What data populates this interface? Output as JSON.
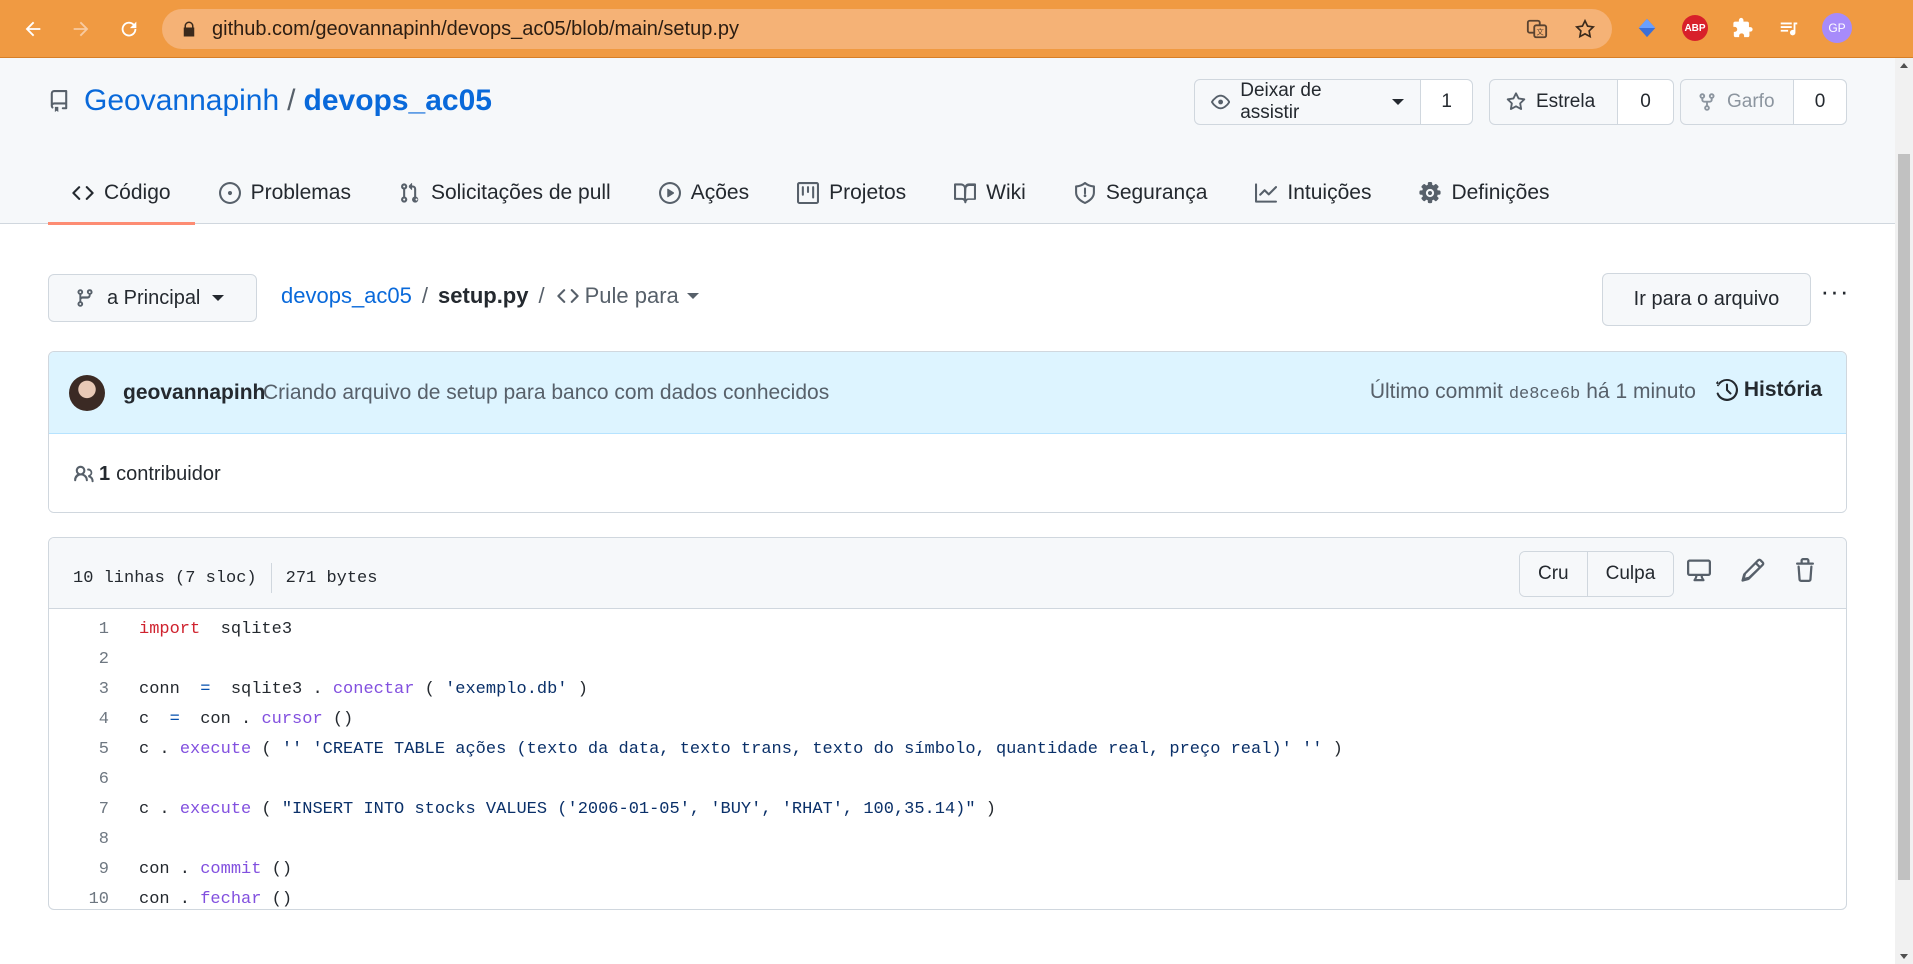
{
  "browser": {
    "url": "github.com/geovannapinh/devops_ac05/blob/main/setup.py",
    "profile_initials": "GP",
    "abp_label": "ABP",
    "accent_color": "#f09a42"
  },
  "repo": {
    "owner": "Geovannapinh",
    "separator": "/",
    "name": "devops_ac05",
    "watch": {
      "label": "Deixar de assistir",
      "count": "1"
    },
    "star": {
      "label": "Estrela",
      "count": "0"
    },
    "fork": {
      "label": "Garfo",
      "count": "0"
    }
  },
  "tabs": [
    {
      "label": "Código",
      "icon": "code-icon",
      "active": true
    },
    {
      "label": "Problemas",
      "icon": "issue-icon"
    },
    {
      "label": "Solicitações de pull",
      "icon": "pull-request-icon"
    },
    {
      "label": "Ações",
      "icon": "play-icon"
    },
    {
      "label": "Projetos",
      "icon": "project-icon"
    },
    {
      "label": "Wiki",
      "icon": "book-icon"
    },
    {
      "label": "Segurança",
      "icon": "shield-icon"
    },
    {
      "label": "Intuições",
      "icon": "graph-icon"
    },
    {
      "label": "Definições",
      "icon": "gear-icon"
    }
  ],
  "breadcrumb": {
    "branch": "a Principal",
    "repo": "devops_ac05",
    "sep": "/",
    "file": "setup.py",
    "sep2": "/",
    "jump": "Pule para",
    "goto_file": "Ir para o arquivo",
    "more": "···"
  },
  "commit": {
    "author": "geovannapinh",
    "message": "Criando arquivo de setup para banco com dados conhecidos",
    "last_commit_label": "Último commit",
    "sha": "de8ce6b",
    "time": "há 1 minuto",
    "history_label": "História",
    "contributors_count": "1",
    "contributors_label": "contribuidor"
  },
  "file": {
    "lines_info": "10 linhas (7 sloc)",
    "size": "271 bytes",
    "raw_label": "Cru",
    "blame_label": "Culpa",
    "code": [
      {
        "n": "1",
        "tokens": [
          {
            "t": "import",
            "c": "kw"
          },
          {
            "t": "  sqlite3",
            "c": ""
          }
        ]
      },
      {
        "n": "2",
        "tokens": []
      },
      {
        "n": "3",
        "tokens": [
          {
            "t": "conn  ",
            "c": ""
          },
          {
            "t": "=",
            "c": "op"
          },
          {
            "t": "  sqlite3 . ",
            "c": ""
          },
          {
            "t": "conectar",
            "c": "fn"
          },
          {
            "t": " ( ",
            "c": ""
          },
          {
            "t": "'exemplo.db'",
            "c": "str"
          },
          {
            "t": " )",
            "c": ""
          }
        ]
      },
      {
        "n": "4",
        "tokens": [
          {
            "t": "c  ",
            "c": ""
          },
          {
            "t": "=",
            "c": "op"
          },
          {
            "t": "  con . ",
            "c": ""
          },
          {
            "t": "cursor",
            "c": "fn"
          },
          {
            "t": " ()",
            "c": ""
          }
        ]
      },
      {
        "n": "5",
        "tokens": [
          {
            "t": "c . ",
            "c": ""
          },
          {
            "t": "execute",
            "c": "fn"
          },
          {
            "t": " ( ",
            "c": ""
          },
          {
            "t": "'' 'CREATE TABLE ações (texto da data, texto trans, texto do símbolo, quantidade real, preço real)' ''",
            "c": "str"
          },
          {
            "t": " )",
            "c": ""
          }
        ]
      },
      {
        "n": "6",
        "tokens": []
      },
      {
        "n": "7",
        "tokens": [
          {
            "t": "c . ",
            "c": ""
          },
          {
            "t": "execute",
            "c": "fn"
          },
          {
            "t": " ( ",
            "c": ""
          },
          {
            "t": "\"INSERT INTO stocks VALUES ('2006-01-05', 'BUY', 'RHAT', 100,35.14)\"",
            "c": "str"
          },
          {
            "t": " )",
            "c": ""
          }
        ]
      },
      {
        "n": "8",
        "tokens": []
      },
      {
        "n": "9",
        "tokens": [
          {
            "t": "con . ",
            "c": ""
          },
          {
            "t": "commit",
            "c": "fn"
          },
          {
            "t": " ()",
            "c": ""
          }
        ]
      },
      {
        "n": "10",
        "tokens": [
          {
            "t": "con . ",
            "c": ""
          },
          {
            "t": "fechar",
            "c": "fn"
          },
          {
            "t": " ()",
            "c": ""
          }
        ]
      }
    ]
  }
}
